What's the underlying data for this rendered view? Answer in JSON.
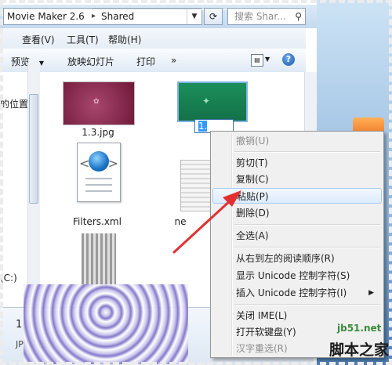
{
  "address": {
    "segments": [
      "Movie Maker 2.6",
      "Shared"
    ],
    "search_placeholder": "搜索 Shar..."
  },
  "menu": [
    "查看(V)",
    "工具(T)",
    "帮助(H)"
  ],
  "toolbar": {
    "preview": "预览",
    "slideshow": "放映幻灯片",
    "print": "打印",
    "more": "»"
  },
  "nav": {
    "location_fragment": "的位置",
    "drive_fragment": "(C:)"
  },
  "files": [
    {
      "name": "1.3.jpg"
    },
    {
      "name": "1.",
      "editing": true
    },
    {
      "name": "Filters.xml"
    },
    {
      "name": "ne"
    }
  ],
  "details": {
    "name_fragment": "1",
    "type_fragment": "JPEG 图像"
  },
  "context_menu": {
    "items": [
      {
        "label": "撤销(U)",
        "disabled": true
      },
      {
        "separator": true
      },
      {
        "label": "剪切(T)"
      },
      {
        "label": "复制(C)"
      },
      {
        "label": "粘贴(P)",
        "highlighted": true
      },
      {
        "label": "删除(D)"
      },
      {
        "separator": true
      },
      {
        "label": "全选(A)"
      },
      {
        "separator": true
      },
      {
        "label": "从右到左的阅读顺序(R)"
      },
      {
        "label": "显示 Unicode 控制字符(S)"
      },
      {
        "label": "插入 Unicode 控制字符(I)",
        "submenu": true
      },
      {
        "separator": true
      },
      {
        "label": "关闭 IME(L)"
      },
      {
        "label": "打开软键盘(Y)"
      },
      {
        "label": "汉字重选(R)",
        "disabled": true
      }
    ]
  },
  "watermark": {
    "site": "jb51.net",
    "name": "脚本之家"
  },
  "colors": {
    "annotation_arrow": "#e23030",
    "menu_highlight": "#dcebfc"
  }
}
